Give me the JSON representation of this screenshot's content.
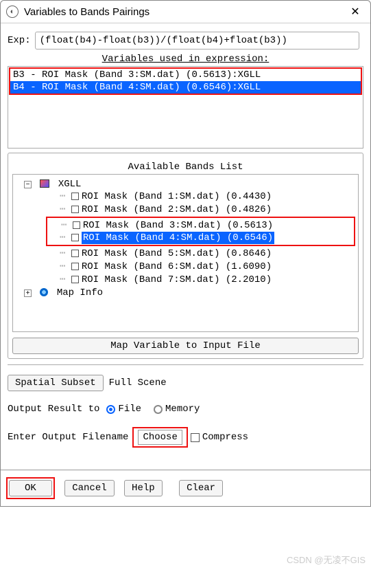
{
  "window": {
    "title": "Variables to Bands Pairings"
  },
  "exp": {
    "label": "Exp:",
    "value": "(float(b4)-float(b3))/(float(b4)+float(b3))"
  },
  "vars_section_title": "Variables used in expression:",
  "vars_list": [
    "B3 - ROI Mask (Band 3:SM.dat) (0.5613):XGLL",
    "B4 - ROI Mask (Band 4:SM.dat) (0.6546):XGLL"
  ],
  "bands_section_title": "Available Bands List",
  "tree": {
    "root": "XGLL",
    "bands": [
      "ROI Mask (Band 1:SM.dat) (0.4430)",
      "ROI Mask (Band 2:SM.dat) (0.4826)",
      "ROI Mask (Band 3:SM.dat) (0.5613)",
      "ROI Mask (Band 4:SM.dat) (0.6546)",
      "ROI Mask (Band 5:SM.dat) (0.8646)",
      "ROI Mask (Band 6:SM.dat) (1.6090)",
      "ROI Mask (Band 7:SM.dat) (2.2010)"
    ],
    "map_info": "Map Info"
  },
  "map_button": "Map Variable to Input File",
  "spatial_subset_btn": "Spatial Subset",
  "spatial_subset_value": "Full Scene",
  "output_label": "Output Result to",
  "output_file": "File",
  "output_memory": "Memory",
  "filename_label": "Enter Output Filename",
  "choose_btn": "Choose",
  "compress_label": "Compress",
  "buttons": {
    "ok": "OK",
    "cancel": "Cancel",
    "help": "Help",
    "clear": "Clear"
  },
  "watermark": "CSDN @无凌不GIS"
}
